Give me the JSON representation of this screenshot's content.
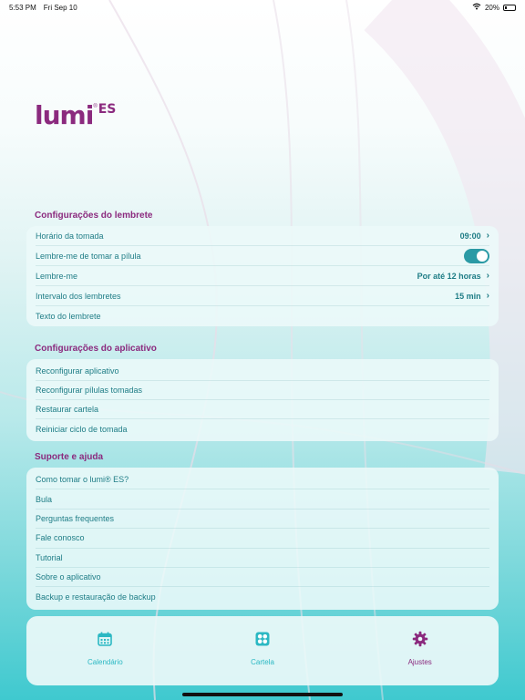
{
  "status_bar": {
    "time": "5:53 PM",
    "date": "Fri Sep 10",
    "battery": "20%"
  },
  "logo": {
    "main": "lumi",
    "reg": "®",
    "suffix": "ES"
  },
  "sections": {
    "reminder": {
      "title": "Configurações do lembrete",
      "rows": [
        {
          "label": "Horário da tomada",
          "value": "09:00"
        },
        {
          "label": "Lembre-me de tomar a pílula",
          "toggle": true
        },
        {
          "label": "Lembre-me",
          "value": "Por até 12 horas"
        },
        {
          "label": "Intervalo dos lembretes",
          "value": "15 min"
        },
        {
          "label": "Texto do lembrete"
        }
      ]
    },
    "app": {
      "title": "Configurações do aplicativo",
      "rows": [
        {
          "label": "Reconfigurar aplicativo"
        },
        {
          "label": "Reconfigurar pílulas tomadas"
        },
        {
          "label": "Restaurar cartela"
        },
        {
          "label": "Reiniciar ciclo de tomada"
        }
      ]
    },
    "support": {
      "title": "Suporte e ajuda",
      "rows": [
        {
          "label": "Como tomar o lumi® ES?"
        },
        {
          "label": "Bula"
        },
        {
          "label": "Perguntas frequentes"
        },
        {
          "label": "Fale conosco"
        },
        {
          "label": "Tutorial"
        },
        {
          "label": "Sobre o aplicativo"
        },
        {
          "label": "Backup e restauração de backup"
        }
      ]
    }
  },
  "tabbar": {
    "tabs": [
      {
        "label": "Calendário",
        "icon": "calendar-icon",
        "active": false
      },
      {
        "label": "Cartela",
        "icon": "pill-pack-icon",
        "active": false
      },
      {
        "label": "Ajustes",
        "icon": "gear-icon",
        "active": true
      }
    ]
  },
  "colors": {
    "accent": "#8b2a7e",
    "teal": "#1f7d86",
    "tab_inactive": "#2bb8c3",
    "toggle_on": "#2a9aa5"
  }
}
